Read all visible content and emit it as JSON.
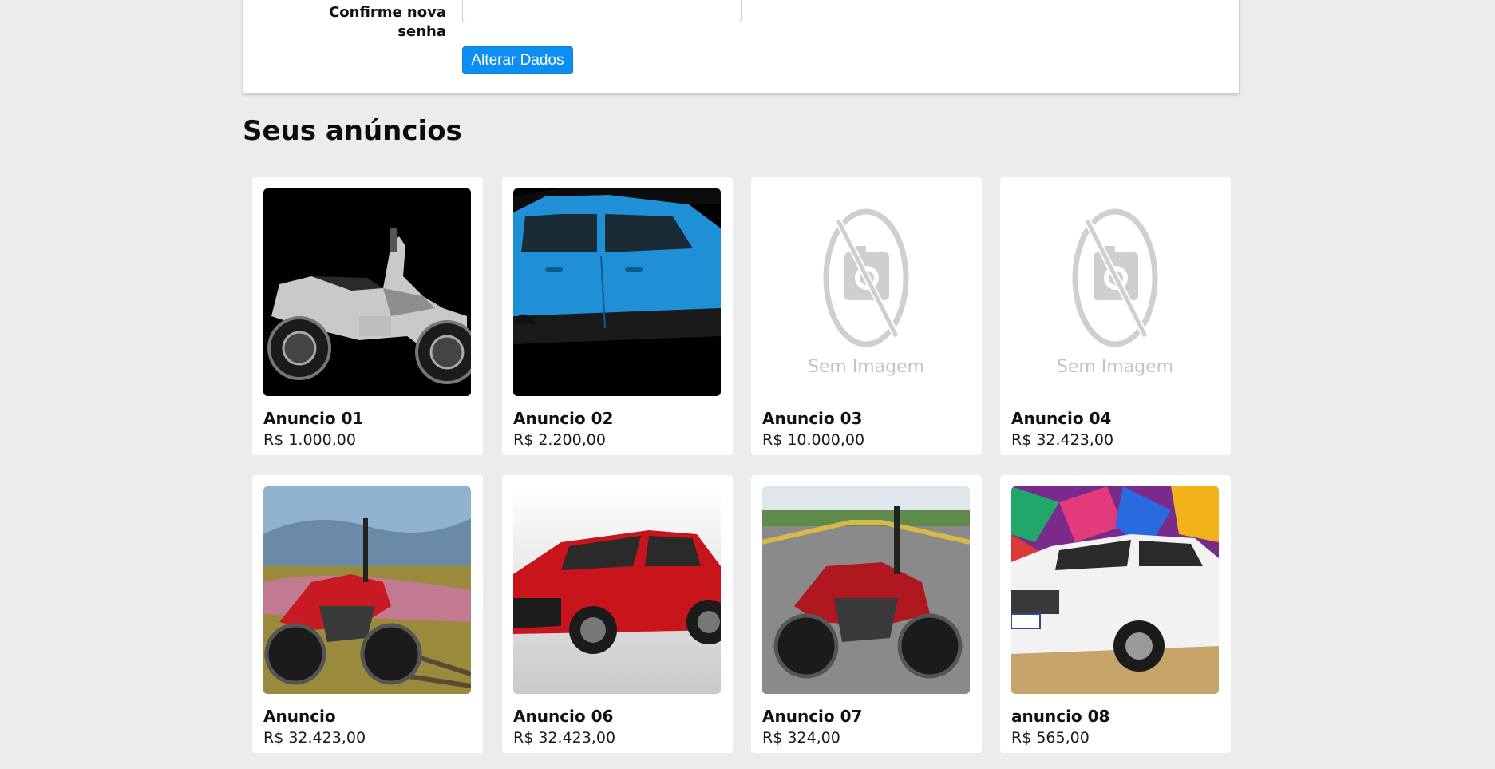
{
  "form": {
    "confirm_label": "Confirme nova senha",
    "confirm_value": "",
    "submit_label": "Alterar Dados",
    "accent_color": "#0d8ef2"
  },
  "listings": {
    "title": "Seus anúncios",
    "no_image_text": "Sem Imagem",
    "items": [
      {
        "title": "Anuncio 01",
        "price": "R$ 1.000,00",
        "image": "motorcycle-scooter-photo"
      },
      {
        "title": "Anuncio 02",
        "price": "R$ 2.200,00",
        "image": "blue-car-photo"
      },
      {
        "title": "Anuncio 03",
        "price": "R$ 10.000,00",
        "image": "no-image-placeholder"
      },
      {
        "title": "Anuncio 04",
        "price": "R$ 32.423,00",
        "image": "no-image-placeholder"
      },
      {
        "title": "Anuncio",
        "price": "R$ 32.423,00",
        "image": "red-trail-motorcycle-photo"
      },
      {
        "title": "Anuncio 06",
        "price": "R$ 32.423,00",
        "image": "red-hatchback-photo"
      },
      {
        "title": "Anuncio 07",
        "price": "R$ 324,00",
        "image": "street-motorcycle-photo"
      },
      {
        "title": "anuncio 08",
        "price": "R$ 565,00",
        "image": "white-suv-photo"
      }
    ]
  }
}
